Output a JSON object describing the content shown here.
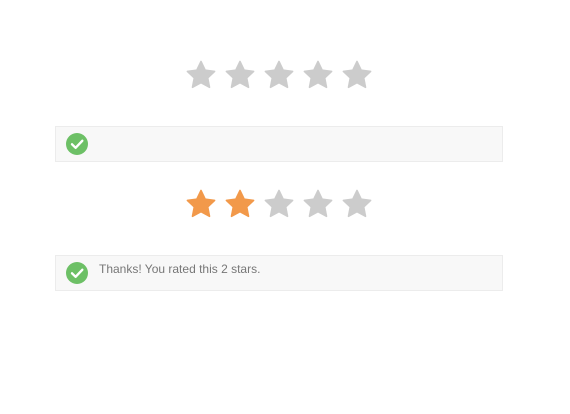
{
  "colors": {
    "star_filled": "#f2994a",
    "star_empty": "#cccccc",
    "success": "#6dc066",
    "alert_background": "#f8f8f8"
  },
  "widgets": [
    {
      "rating": {
        "value": 0,
        "max": 5
      },
      "message": {
        "icon": "check-circle-icon",
        "text": ""
      }
    },
    {
      "rating": {
        "value": 2,
        "max": 5
      },
      "message": {
        "icon": "check-circle-icon",
        "text": "Thanks! You rated this 2 stars."
      }
    }
  ]
}
